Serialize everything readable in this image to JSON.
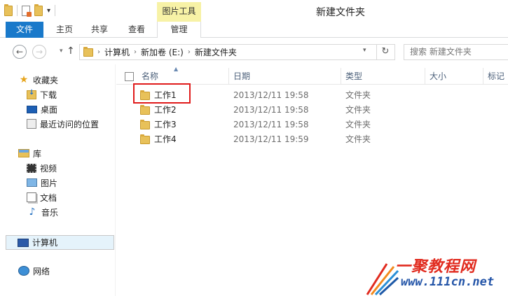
{
  "window": {
    "title": "新建文件夹",
    "contextual_tab": "图片工具"
  },
  "ribbon": {
    "tabs": [
      {
        "label": "文件"
      },
      {
        "label": "主页"
      },
      {
        "label": "共享"
      },
      {
        "label": "查看"
      },
      {
        "label": "管理"
      }
    ]
  },
  "address": {
    "crumbs": [
      "计算机",
      "新加卷 (E:)",
      "新建文件夹"
    ]
  },
  "search": {
    "placeholder": "搜索 新建文件夹"
  },
  "nav": {
    "favorites": {
      "label": "收藏夹",
      "items": [
        "下载",
        "桌面",
        "最近访问的位置"
      ]
    },
    "libraries": {
      "label": "库",
      "items": [
        "视频",
        "图片",
        "文档",
        "音乐"
      ]
    },
    "computer": "计算机",
    "network": "网络"
  },
  "columns": {
    "name": "名称",
    "date": "日期",
    "type": "类型",
    "size": "大小",
    "tags": "标记"
  },
  "files": [
    {
      "name": "工作1",
      "date": "2013/12/11 19:58",
      "type": "文件夹"
    },
    {
      "name": "工作2",
      "date": "2013/12/11 19:58",
      "type": "文件夹"
    },
    {
      "name": "工作3",
      "date": "2013/12/11 19:58",
      "type": "文件夹"
    },
    {
      "name": "工作4",
      "date": "2013/12/11 19:59",
      "type": "文件夹"
    }
  ],
  "watermark": {
    "title": "一聚教程网",
    "url": "www.111cn.net"
  },
  "colors": {
    "accent": "#1979ca",
    "highlight": "#e01b1b",
    "context_tab": "#f7f2a6"
  }
}
